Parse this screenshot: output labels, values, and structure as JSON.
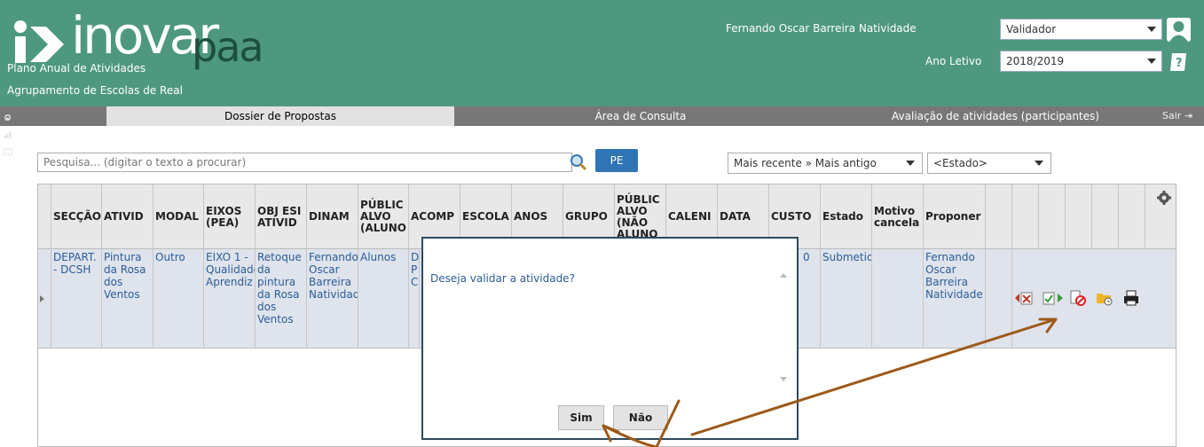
{
  "header": {
    "logo_main": "inovar",
    "logo_accent": "paa",
    "subtitle": "Plano Anual de Atividades",
    "school": "Agrupamento de Escolas de Real",
    "user_name": "Fernando Oscar Barreira Natividade",
    "role_selected": "Validador",
    "year_label": "Ano Letivo",
    "year_selected": "2018/2019"
  },
  "tabs": [
    {
      "label": "Dossier de Propostas",
      "active": true
    },
    {
      "label": "Área de Consulta"
    },
    {
      "label": "Avaliação de atividades (participantes)"
    }
  ],
  "logout_label": "Sair",
  "toolbar": {
    "search_placeholder": "Pesquisa... (digitar o texto a procurar)",
    "pe_label": "PE",
    "sort_selected": "Mais recente » Mais antigo",
    "estado_selected": "<Estado>"
  },
  "grid": {
    "columns": [
      "SECÇÃO",
      "ATIVID",
      "MODAL",
      "EIXOS (PEA)",
      "OBJ ESI ATIVID",
      "DINAM",
      "PÚBLIC ALVO (ALUNO",
      "ACOMP",
      "ESCOLA",
      "ANOS",
      "GRUPO",
      "PÚBLIC ALVO (NÃO ALUNO",
      "CALENI",
      "DATA",
      "CUSTO",
      "Estado",
      "Motivo cancela",
      "Proponer"
    ],
    "row": {
      "seccao": "DEPART. - DCSH",
      "atividade": "Pintura da Rosa dos Ventos",
      "modalidade": "Outro",
      "eixos": "EIXO 1 - Qualidade Aprendiz",
      "objetivos": "Retoque da pintura da Rosa dos Ventos",
      "dinamizador": "Fernando Oscar Barreira Natividade",
      "publico_alvo": "Alunos",
      "acomp_partial": "D P C",
      "custo_partial": "0",
      "estado": "Submetid",
      "proponente": "Fernando Oscar Barreira Natividade"
    }
  },
  "modal": {
    "message": "Deseja validar a atividade?",
    "confirm_label": "Sim",
    "cancel_label": "Não"
  },
  "colors": {
    "header_bg": "#4e9880",
    "tabbar_bg": "#777777",
    "link_text": "#2b5d97",
    "pe_button": "#2f75b5",
    "arrow": "#9c5a1a"
  }
}
